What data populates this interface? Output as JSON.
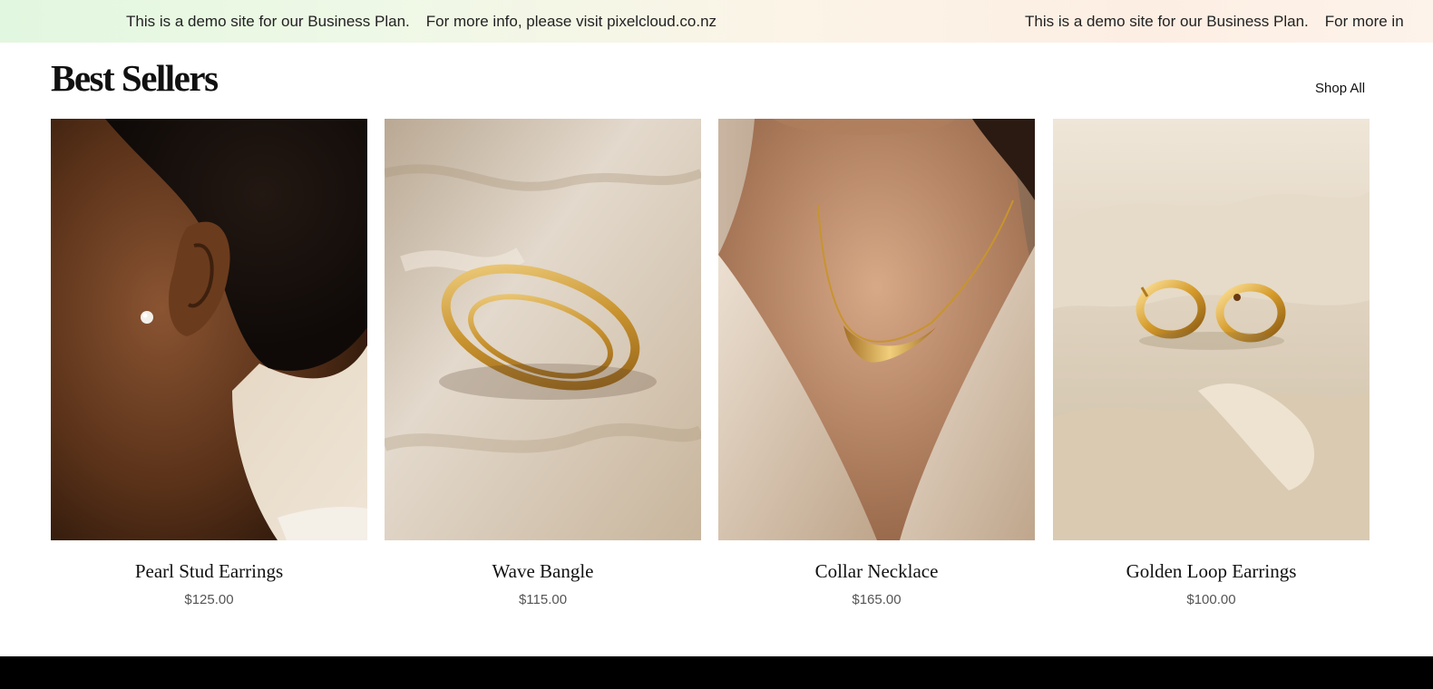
{
  "announcement": {
    "line1": "This is a demo site for our Business Plan.",
    "line2": "For more info, please visit pixelcloud.co.nz",
    "repeat_line1": "This is a demo site for our Business Plan.",
    "repeat_line2": "For more in"
  },
  "section": {
    "title": "Best Sellers",
    "shop_all": "Shop All"
  },
  "products": [
    {
      "name": "Pearl Stud Earrings",
      "price": "$125.00",
      "image": "ear-with-pearl-stud-photo"
    },
    {
      "name": "Wave Bangle",
      "price": "$115.00",
      "image": "gold-bangle-on-linen-photo"
    },
    {
      "name": "Collar Necklace",
      "price": "$165.00",
      "image": "gold-collar-necklace-on-neck-photo"
    },
    {
      "name": "Golden Loop Earrings",
      "price": "$100.00",
      "image": "gold-hoops-on-sand-photo"
    }
  ],
  "colors": {
    "banner_start": "#e2f7df",
    "banner_end": "#fdeee3",
    "footer": "#000000",
    "price_text": "#555555"
  }
}
